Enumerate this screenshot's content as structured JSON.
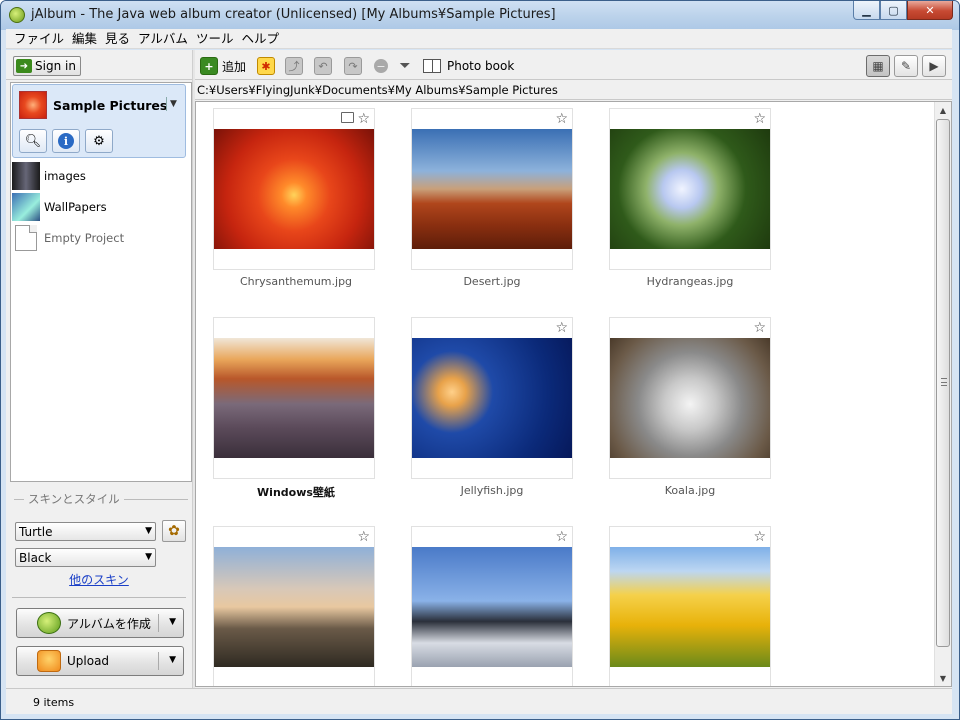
{
  "window": {
    "title": "jAlbum - The Java web album creator (Unlicensed) [My Albums¥Sample Pictures]"
  },
  "menu": [
    "ファイル",
    "編集",
    "見る",
    "アルバム",
    "ツール",
    "ヘルプ"
  ],
  "left_panel": {
    "sign_in_label": "Sign in",
    "current_project": "Sample Pictures",
    "projects": [
      {
        "label": "images"
      },
      {
        "label": "WallPapers"
      },
      {
        "label": "Empty Project"
      }
    ],
    "skin_section_label": "スキンとスタイル",
    "skin_select": "Turtle",
    "style_select": "Black",
    "more_skins_link": "他のスキン",
    "make_album_button": "アルバムを作成",
    "upload_button": "Upload"
  },
  "toolbar": {
    "add_label": "追加",
    "photo_book_label": "Photo book"
  },
  "path": "C:¥Users¥FlyingJunk¥Documents¥My Albums¥Sample Pictures",
  "gallery": {
    "items": [
      {
        "label": "Chrysanthemum.jpg",
        "image": "chrysanthemum",
        "folder": true,
        "bold": false
      },
      {
        "label": "Desert.jpg",
        "image": "desert",
        "folder": false,
        "bold": false
      },
      {
        "label": "Hydrangeas.jpg",
        "image": "hydrangeas",
        "folder": false,
        "bold": false
      },
      {
        "label": "Windows壁紙",
        "image": "windows-arch",
        "folder": false,
        "bold": true
      },
      {
        "label": "Jellyfish.jpg",
        "image": "jellyfish",
        "folder": false,
        "bold": false
      },
      {
        "label": "Koala.jpg",
        "image": "koala",
        "folder": false,
        "bold": false
      },
      {
        "label": "",
        "image": "lighthouse",
        "folder": false,
        "bold": false
      },
      {
        "label": "",
        "image": "penguins",
        "folder": false,
        "bold": false
      },
      {
        "label": "",
        "image": "tulips",
        "folder": false,
        "bold": false
      }
    ]
  },
  "status": {
    "item_count": "9 items"
  }
}
